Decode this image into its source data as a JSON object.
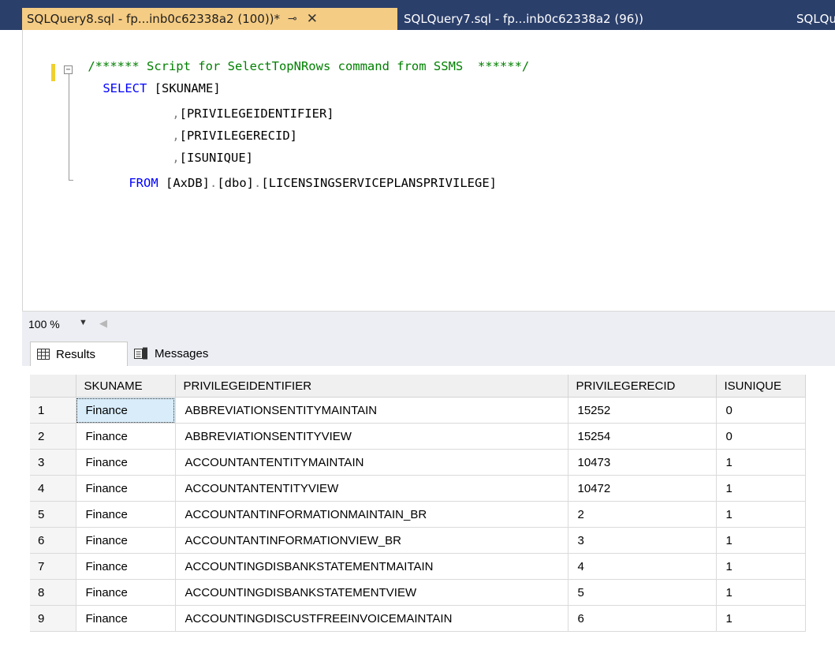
{
  "tabs": [
    {
      "title": "SQLQuery8.sql - fp...inb0c62338a2 (100))*",
      "pin": "⊸",
      "close": "✕"
    },
    {
      "title": "SQLQuery7.sql - fp...inb0c62338a2 (96))"
    },
    {
      "title": "SQLQu"
    }
  ],
  "editor": {
    "comment": "/****** Script for SelectTopNRows command from SSMS  ******/",
    "select_kw": "SELECT",
    "col1": " [SKUNAME]",
    "col2": "[PRIVILEGEIDENTIFIER]",
    "col3": "[PRIVILEGERECID]",
    "col4": "[ISUNIQUE]",
    "comma": ",",
    "from_kw": "FROM",
    "db": "[AxDB]",
    "schema": "[dbo]",
    "table": "[LICENSINGSERVICEPLANSPRIVILEGE]",
    "dot": ".",
    "fold_glyph": "−"
  },
  "zoom": {
    "value": "100 %"
  },
  "results_tabs": [
    {
      "label": "Results",
      "icon": "grid-icon"
    },
    {
      "label": "Messages",
      "icon": "messages-icon"
    }
  ],
  "grid": {
    "columns": [
      "SKUNAME",
      "PRIVILEGEIDENTIFIER",
      "PRIVILEGERECID",
      "ISUNIQUE"
    ],
    "rows": [
      [
        "1",
        "Finance",
        "ABBREVIATIONSENTITYMAINTAIN",
        "15252",
        "0"
      ],
      [
        "2",
        "Finance",
        "ABBREVIATIONSENTITYVIEW",
        "15254",
        "0"
      ],
      [
        "3",
        "Finance",
        "ACCOUNTANTENTITYMAINTAIN",
        "10473",
        "1"
      ],
      [
        "4",
        "Finance",
        "ACCOUNTANTENTITYVIEW",
        "10472",
        "1"
      ],
      [
        "5",
        "Finance",
        "ACCOUNTANTINFORMATIONMAINTAIN_BR",
        "2",
        "1"
      ],
      [
        "6",
        "Finance",
        "ACCOUNTANTINFORMATIONVIEW_BR",
        "3",
        "1"
      ],
      [
        "7",
        "Finance",
        "ACCOUNTINGDISBANKSTATEMENTMAITAIN",
        "4",
        "1"
      ],
      [
        "8",
        "Finance",
        "ACCOUNTINGDISBANKSTATEMENTVIEW",
        "5",
        "1"
      ],
      [
        "9",
        "Finance",
        "ACCOUNTINGDISCUSTFREEINVOICEMAINTAIN",
        "6",
        "1"
      ]
    ]
  }
}
